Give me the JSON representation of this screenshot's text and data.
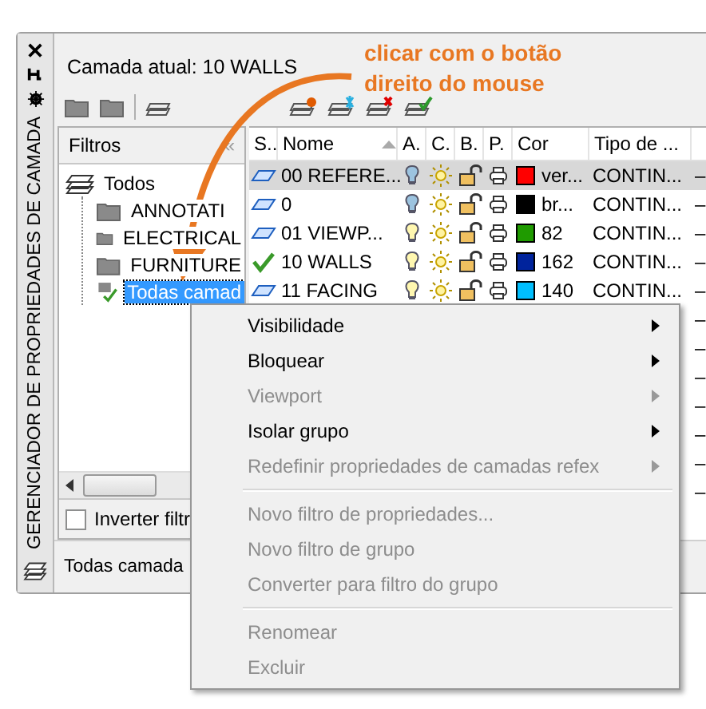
{
  "panel_title": "GERENCIADOR DE PROPRIEDADES DE CAMADA",
  "current_layer": "Camada atual: 10 WALLS",
  "annotation": "clicar com o botão direito do mouse",
  "filters": {
    "header": "Filtros",
    "collapse": "«",
    "tree": [
      {
        "label": "Todos",
        "expanded": true,
        "selected": false,
        "kind": "root",
        "children": [
          {
            "label": "ANNOTATI",
            "selected": false,
            "kind": "group"
          },
          {
            "label": "ELECTRICAL",
            "selected": false,
            "kind": "group"
          },
          {
            "label": "FURNITURE",
            "selected": false,
            "kind": "group"
          },
          {
            "label": "Todas camad",
            "selected": true,
            "kind": "used"
          }
        ]
      }
    ]
  },
  "invert_filter": {
    "label": "Inverter filtr",
    "checked": false
  },
  "status": "Todas camada",
  "table": {
    "columns": [
      "S..",
      "Nome",
      "A.",
      "C.",
      "B.",
      "P.",
      "Cor",
      "Tipo de ..."
    ],
    "rows": [
      {
        "current": false,
        "name": "00 REFERE...",
        "on": false,
        "color": "#ff0000",
        "color_name": "ver...",
        "linetype": "CONTIN...",
        "column_9": "–",
        "selected": true
      },
      {
        "current": false,
        "name": "0",
        "on": false,
        "color": "#000000",
        "color_name": "br...",
        "linetype": "CONTIN...",
        "column_9": "–",
        "selected": false
      },
      {
        "current": false,
        "name": "01 VIEWP...",
        "on": true,
        "color": "#1f9b00",
        "color_name": "82",
        "linetype": "CONTIN...",
        "column_9": "–",
        "selected": false
      },
      {
        "current": true,
        "name": "10 WALLS",
        "on": true,
        "color": "#00239c",
        "color_name": "162",
        "linetype": "CONTIN...",
        "column_9": "–",
        "selected": false
      },
      {
        "current": false,
        "name": "11 FACING",
        "on": true,
        "color": "#00bfff",
        "color_name": "140",
        "linetype": "CONTIN...",
        "column_9": "–",
        "selected": false
      }
    ],
    "hidden_rows": [
      "–",
      "–",
      "–",
      "–",
      "–",
      "–",
      "–"
    ]
  },
  "context_menu": [
    {
      "kind": "item",
      "label": "Visibilidade",
      "disabled": false,
      "submenu": true
    },
    {
      "kind": "item",
      "label": "Bloquear",
      "disabled": false,
      "submenu": true
    },
    {
      "kind": "item",
      "label": "Viewport",
      "disabled": true,
      "submenu": true
    },
    {
      "kind": "item",
      "label": "Isolar grupo",
      "disabled": false,
      "submenu": true
    },
    {
      "kind": "item",
      "label": "Redefinir propriedades de camadas refex",
      "disabled": true,
      "submenu": true
    },
    {
      "kind": "separator"
    },
    {
      "kind": "item",
      "label": "Novo filtro de propriedades...",
      "disabled": true,
      "submenu": false
    },
    {
      "kind": "item",
      "label": "Novo filtro de grupo",
      "disabled": true,
      "submenu": false
    },
    {
      "kind": "item",
      "label": "Converter para filtro do grupo",
      "disabled": true,
      "submenu": false
    },
    {
      "kind": "separator"
    },
    {
      "kind": "item",
      "label": "Renomear",
      "disabled": true,
      "submenu": false
    },
    {
      "kind": "item",
      "label": "Excluir",
      "disabled": true,
      "submenu": false
    }
  ]
}
